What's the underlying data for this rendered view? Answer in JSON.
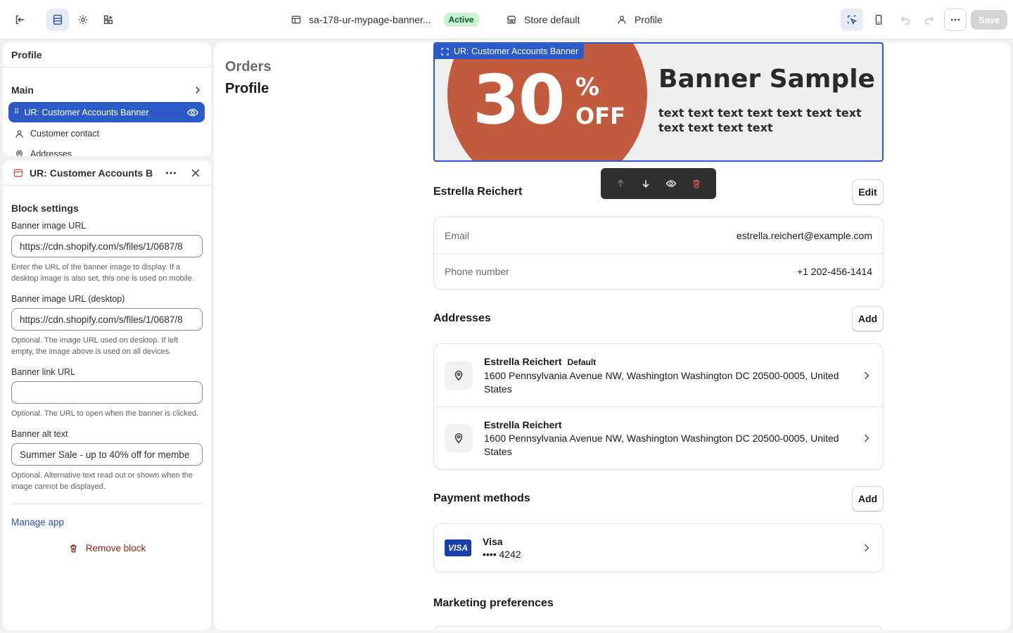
{
  "topbar": {
    "theme_name": "sa-178-ur-mypage-banner...",
    "status": "Active",
    "store": "Store default",
    "page": "Profile",
    "save_label": "Save"
  },
  "tree": {
    "header": "Profile",
    "main": "Main",
    "selected": "UR: Customer Accounts Banner",
    "items": [
      "Customer contact",
      "Addresses"
    ]
  },
  "settings": {
    "header": "UR: Customer Accounts B",
    "section": "Block settings",
    "fields": [
      {
        "label": "Banner image URL",
        "value": "https://cdn.shopify.com/s/files/1/0687/8",
        "help": "Enter the URL of the banner image to display. If a desktop image is also set, this one is used on mobile."
      },
      {
        "label": "Banner image URL (desktop)",
        "value": "https://cdn.shopify.com/s/files/1/0687/8",
        "help": "Optional. The image URL used on desktop. If left empty, the image above is used on all devices."
      },
      {
        "label": "Banner link URL",
        "value": "",
        "help": "Optional. The URL to open when the banner is clicked."
      },
      {
        "label": "Banner alt text",
        "value": "Summer Sale - up to 40% off for membe",
        "help": "Optional. Alternative text read out or shown when the image cannot be displayed."
      }
    ],
    "manage_app": "Manage app",
    "remove_block": "Remove block"
  },
  "preview": {
    "nav": [
      "Orders",
      "Profile"
    ],
    "banner_tag": "UR: Customer Accounts Banner",
    "banner": {
      "number": "30",
      "percent": "%",
      "off": "OFF",
      "title": "Banner Sample",
      "text": "text text text text text text text text text text text"
    },
    "customer_name": "Estrella Reichert",
    "edit_label": "Edit",
    "contact": [
      {
        "k": "Email",
        "v": "estrella.reichert@example.com"
      },
      {
        "k": "Phone number",
        "v": "+1 202-456-1414"
      }
    ],
    "addresses_title": "Addresses",
    "add_label": "Add",
    "addresses": [
      {
        "name": "Estrella Reichert",
        "tag": "Default",
        "line": "1600 Pennsylvania Avenue NW, Washington Washington DC 20500-0005, United States"
      },
      {
        "name": "Estrella Reichert",
        "tag": "",
        "line": "1600 Pennsylvania Avenue NW, Washington Washington DC 20500-0005, United States"
      }
    ],
    "payment_title": "Payment methods",
    "payment": {
      "brand": "Visa",
      "logo": "VISA",
      "masked": "•••• 4242"
    },
    "marketing_title": "Marketing preferences"
  },
  "colors": {
    "accent": "#2c5bc9",
    "banner_circle": "#c25a3e",
    "active_badge": "#c9f2d0"
  }
}
